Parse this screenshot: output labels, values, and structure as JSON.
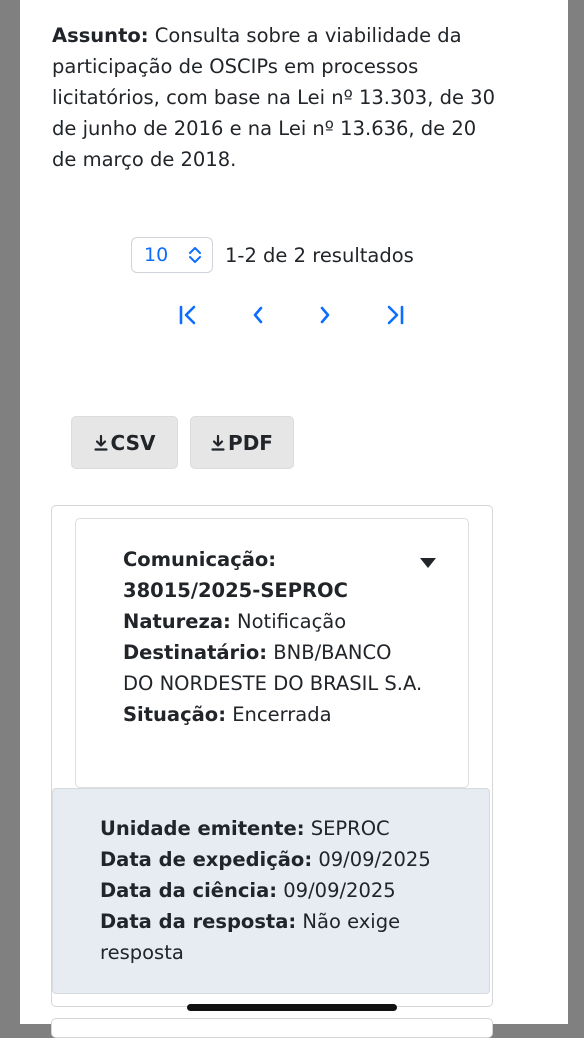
{
  "subject": {
    "label": "Assunto:",
    "text": " Consulta sobre a viabilidade da participação de OSCIPs em processos licitatórios, com base na Lei nº 13.303, de 30 de junho de 2016 e na Lei nº 13.636, de 20 de março de 2018."
  },
  "pagination": {
    "page_size": "10",
    "results": "1-2 de 2 resultados",
    "accent_color": "#0d6efd",
    "nav_icons": [
      "first-page-icon",
      "prev-page-icon",
      "next-page-icon",
      "last-page-icon"
    ]
  },
  "export": {
    "csv_label": "CSV",
    "pdf_label": "PDF"
  },
  "card": {
    "comunicacao_label": "Comunicação:",
    "comunicacao_value": "38015/2025-SEPROC",
    "natureza_label": "Natureza:",
    "natureza_value": " Notificação",
    "destinatario_label": "Destinatário:",
    "destinatario_value": " BNB/BANCO DO NORDESTE DO BRASIL S.A.",
    "situacao_label": "Situação:",
    "situacao_value": " Encerrada"
  },
  "details": {
    "unidade_label": "Unidade emitente:",
    "unidade_value": " SEPROC",
    "expedicao_label": "Data de expedição:",
    "expedicao_value": " 09/09/2025",
    "ciencia_label": "Data da ciência:",
    "ciencia_value": " 09/09/2025",
    "resposta_label": "Data da resposta:",
    "resposta_value": " Não exige resposta"
  }
}
